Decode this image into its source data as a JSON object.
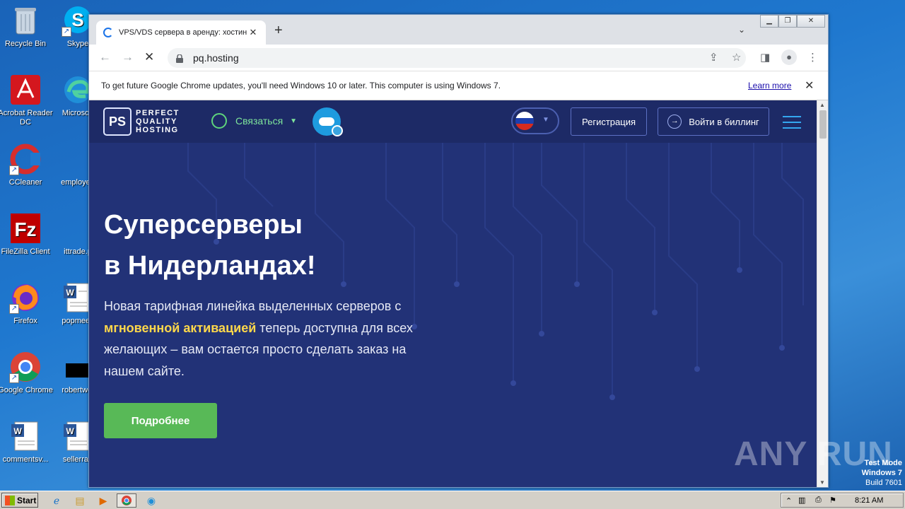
{
  "desktop": {
    "icons": [
      {
        "label": "Recycle Bin",
        "icon": "recycle-bin-icon"
      },
      {
        "label": "Skype",
        "icon": "skype-icon"
      },
      {
        "label": "Acrobat Reader DC",
        "icon": "acrobat-icon"
      },
      {
        "label": "Microsoft",
        "icon": "edge-icon"
      },
      {
        "label": "CCleaner",
        "icon": "ccleaner-icon"
      },
      {
        "label": "employee",
        "icon": "file-icon"
      },
      {
        "label": "FileZilla Client",
        "icon": "filezilla-icon"
      },
      {
        "label": "ittrade.p",
        "icon": "file-icon"
      },
      {
        "label": "Firefox",
        "icon": "firefox-icon"
      },
      {
        "label": "popmeeti",
        "icon": "word-doc-icon"
      },
      {
        "label": "Google Chrome",
        "icon": "chrome-icon"
      },
      {
        "label": "robertwel",
        "icon": "file-icon"
      },
      {
        "label": "commentsv...",
        "icon": "word-doc-icon"
      },
      {
        "label": "sellerrap",
        "icon": "word-doc-icon"
      }
    ]
  },
  "browser": {
    "tab_title": "VPS/VDS сервера в аренду: хостинг",
    "url": "pq.hosting",
    "infobar_text": "To get future Google Chrome updates, you'll need Windows 10 or later. This computer is using Windows 7.",
    "infobar_link": "Learn more"
  },
  "site": {
    "logo_mark": "PS",
    "logo_lines": [
      "PERFECT",
      "QUALITY",
      "HOSTING"
    ],
    "contact_label": "Связаться",
    "register_label": "Регистрация",
    "login_label": "Войти в биллинг",
    "hero_title_line1": "Суперсерверы",
    "hero_title_line2": "в Нидерландах!",
    "hero_text_before": "Новая тарифная линейка выделенных серверов с ",
    "hero_text_highlight": "мгновенной активацией",
    "hero_text_after": " теперь доступна для всех желающих – вам остается просто сделать заказ на нашем сайте.",
    "cta_label": "Подробнее",
    "colors": {
      "bg": "#223277",
      "header": "#1d2a66",
      "cta": "#58b957",
      "highlight": "#ffd84a"
    }
  },
  "watermark": "ANY RUN",
  "testmode": {
    "line1": "Test Mode",
    "line2": "Windows 7",
    "line3": "Build 7601"
  },
  "taskbar": {
    "start_label": "Start",
    "clock": "8:21 AM"
  }
}
